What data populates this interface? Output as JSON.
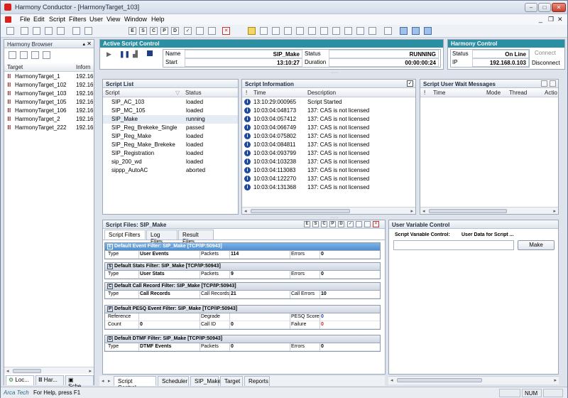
{
  "window": {
    "title": "Harmony Conductor - [HarmonyTarget_103]"
  },
  "menu": [
    "File",
    "Edit",
    "Script",
    "Filters",
    "User",
    "View",
    "Window",
    "Help"
  ],
  "toolbar": {
    "letters": [
      "E",
      "S",
      "C",
      "P",
      "D"
    ]
  },
  "browser": {
    "title": "Harmony Browser",
    "col_target": "Target",
    "col_info": "Inforn",
    "rows": [
      {
        "name": "HarmonyTarget_1",
        "info": "192.16"
      },
      {
        "name": "HarmonyTarget_102",
        "info": "192.16"
      },
      {
        "name": "HarmonyTarget_103",
        "info": "192.16"
      },
      {
        "name": "HarmonyTarget_105",
        "info": "192.16"
      },
      {
        "name": "HarmonyTarget_106",
        "info": "192.16"
      },
      {
        "name": "HarmonyTarget_2",
        "info": "192.16"
      },
      {
        "name": "HarmonyTarget_222",
        "info": "192.16"
      }
    ],
    "tabs": [
      "Loc...",
      "Har...",
      "Sche..."
    ]
  },
  "active_control": {
    "title": "Active Script Control",
    "name_label": "Name",
    "name_value": "SIP_Make",
    "status_label": "Status",
    "status_value": "RUNNING",
    "start_label": "Start",
    "start_value": "13:10:27",
    "duration_label": "Duration",
    "duration_value": "00:00:00:24"
  },
  "harmony_control": {
    "title": "Harmony Control",
    "status_label": "Status",
    "status_value": "On Line",
    "ip_label": "IP",
    "ip_value": "192.168.0.103",
    "connect": "Connect",
    "disconnect": "Disconnect"
  },
  "script_list": {
    "title": "Script List",
    "col_script": "Script",
    "col_status": "Status",
    "rows": [
      {
        "name": "SIP_AC_103",
        "status": "loaded"
      },
      {
        "name": "SIP_MC_105",
        "status": "loaded"
      },
      {
        "name": "SIP_Make",
        "status": "running"
      },
      {
        "name": "SIP_Reg_Brekeke_Single",
        "status": "passed"
      },
      {
        "name": "SIP_Reg_Make",
        "status": "loaded"
      },
      {
        "name": "SIP_Reg_Make_Brekeke",
        "status": "loaded"
      },
      {
        "name": "SIP_Registration",
        "status": "loaded"
      },
      {
        "name": "sip_200_wd",
        "status": "loaded"
      },
      {
        "name": "sippp_AutoAC",
        "status": "aborted"
      }
    ]
  },
  "script_info": {
    "title": "Script Information",
    "col_flag": "!",
    "col_time": "Time",
    "col_desc": "Description",
    "rows": [
      {
        "time": "13:10:29:000965",
        "desc": "Script Started"
      },
      {
        "time": "10:03:04:048173",
        "desc": "137: CAS is not licensed"
      },
      {
        "time": "10:03:04:057412",
        "desc": "137: CAS is not licensed"
      },
      {
        "time": "10:03:04:066749",
        "desc": "137: CAS is not licensed"
      },
      {
        "time": "10:03:04:075802",
        "desc": "137: CAS is not licensed"
      },
      {
        "time": "10:03:04:084811",
        "desc": "137: CAS is not licensed"
      },
      {
        "time": "10:03:04:093799",
        "desc": "137: CAS is not licensed"
      },
      {
        "time": "10:03:04:103238",
        "desc": "137: CAS is not licensed"
      },
      {
        "time": "10:03:04:113083",
        "desc": "137: CAS is not licensed"
      },
      {
        "time": "10:03:04:122270",
        "desc": "137: CAS is not licensed"
      },
      {
        "time": "10:03:04:131368",
        "desc": "137: CAS is not licensed"
      }
    ]
  },
  "wait_messages": {
    "title": "Script User Wait Messages",
    "col_flag": "!",
    "col_time": "Time",
    "col_mode": "Mode",
    "col_thread": "Thread",
    "col_action": "Actio"
  },
  "script_files": {
    "title": "Script Files: SIP_Make",
    "tabs": [
      "Script Filters",
      "Log Files",
      "Result Files"
    ],
    "filters": [
      {
        "letter": "E",
        "title": "Default Event Filter: SIP_Make [TCP/IP:50943]",
        "rows": [
          [
            "Type",
            "User Events",
            "Packets",
            "114",
            "Errors",
            "0"
          ]
        ]
      },
      {
        "letter": "S",
        "title": "Default Stats Filter: SIP_Make [TCP/IP:50943]",
        "rows": [
          [
            "Type",
            "User Stats",
            "Packets",
            "9",
            "Errors",
            "0"
          ]
        ]
      },
      {
        "letter": "C",
        "title": "Default Call Record Filter: SIP_Make [TCP/IP:50943]",
        "rows": [
          [
            "Type",
            "Call Records",
            "Call Records",
            "21",
            "Call Errors",
            "10"
          ]
        ]
      },
      {
        "letter": "P",
        "title": "Default PESQ Event Filter: SIP_Make [TCP/IP:50943]",
        "rows": [
          [
            "Reference",
            "",
            "Degrade",
            "",
            "PESQ Score",
            "0"
          ],
          [
            "Count",
            "0",
            "Call ID",
            "0",
            "Failure",
            "0"
          ]
        ]
      },
      {
        "letter": "D",
        "title": "Default DTMF Filter: SIP_Make [TCP/IP:50943]",
        "rows": [
          [
            "Type",
            "DTMF Events",
            "Packets",
            "0",
            "Errors",
            "0"
          ]
        ]
      }
    ]
  },
  "user_var": {
    "title": "User Variable Control",
    "label_control": "Script Variable Control:",
    "label_data": "User Data for Script ...",
    "make": "Make"
  },
  "bottom_tabs": [
    "Script Control",
    "Scheduler",
    "SIP_Make",
    "Target",
    "Reports"
  ],
  "status": {
    "brand": "Arca Tech",
    "help": "For Help, press F1",
    "num": "NUM"
  },
  "colors": {
    "accent": "#2a8fa2",
    "info_icon": "#1f4aa0",
    "failure": "#d02020"
  }
}
